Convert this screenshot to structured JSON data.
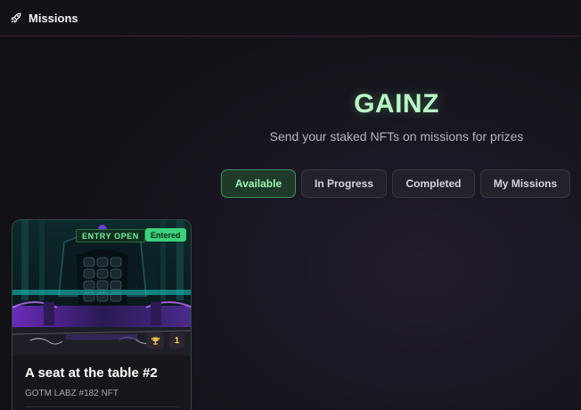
{
  "header": {
    "title": "Missions",
    "icon": "rocket-icon"
  },
  "hero": {
    "title": "GAINZ",
    "subtitle": "Send your staked NFTs on missions for prizes"
  },
  "tabs": [
    {
      "label": "Available",
      "active": true
    },
    {
      "label": "In Progress",
      "active": false
    },
    {
      "label": "Completed",
      "active": false
    },
    {
      "label": "My Missions",
      "active": false
    }
  ],
  "missions": [
    {
      "status_badge": "ENTRY OPEN",
      "entered_badge": "Entered",
      "title": "A seat at the table #2",
      "subtitle": "GOTM LABZ #182 NFT",
      "prize_icon": "trophy-icon",
      "prize_count": "1"
    }
  ],
  "colors": {
    "accent_green": "#9ef5b4",
    "entered_green": "#3bd27a",
    "border_purple": "#3a2346"
  }
}
